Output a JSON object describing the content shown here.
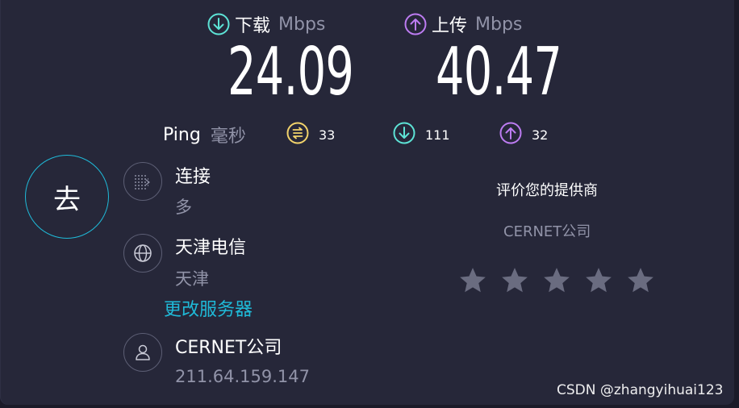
{
  "download": {
    "label": "下载",
    "unit": "Mbps",
    "value": "24.09",
    "icon": "arrow-down-circle-icon",
    "color": "#5de3d6"
  },
  "upload": {
    "label": "上传",
    "unit": "Mbps",
    "value": "40.47",
    "icon": "arrow-up-circle-icon",
    "color": "#bd7cf2"
  },
  "ping": {
    "label": "Ping",
    "unit": "毫秒",
    "idle": {
      "value": "33",
      "icon": "ping-idle-icon",
      "color": "#f2d36b"
    },
    "download": {
      "value": "111",
      "icon": "arrow-down-circle-icon",
      "color": "#5de3d6"
    },
    "upload": {
      "value": "32",
      "icon": "arrow-up-circle-icon",
      "color": "#bd7cf2"
    }
  },
  "go_button": {
    "label": "去"
  },
  "connection": {
    "title": "连接",
    "value": "多",
    "icon": "connections-icon"
  },
  "server": {
    "title": "天津电信",
    "location": "天津",
    "change_link": "更改服务器",
    "icon": "globe-icon"
  },
  "provider": {
    "title": "CERNET公司",
    "ip": "211.64.159.147",
    "icon": "user-icon"
  },
  "rating": {
    "title": "评价您的提供商",
    "provider_name": "CERNET公司",
    "stars_total": 5,
    "stars_selected": 0
  },
  "watermark": "CSDN @zhangyihuai123",
  "colors": {
    "accent": "#1fbad8",
    "background": "#262739",
    "muted": "#9193a8",
    "star": "#6a6c80"
  }
}
